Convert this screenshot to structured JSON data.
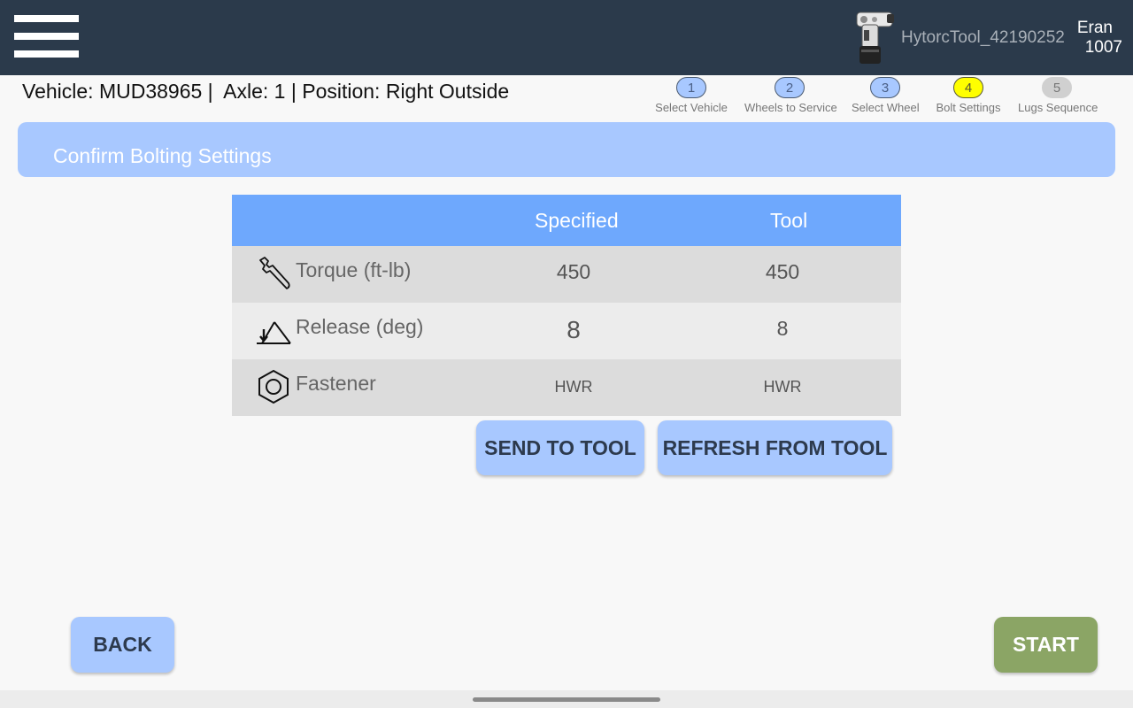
{
  "header": {
    "tool_name": "HytorcTool_42190252",
    "user_name": "Eran",
    "user_id": "1007"
  },
  "vehicle_info": "Vehicle: MUD38965 |  Axle: 1 | Position: Right Outside",
  "steps": [
    {
      "number": "1",
      "label": "Select Vehicle",
      "state": "done"
    },
    {
      "number": "2",
      "label": "Wheels to Service",
      "state": "done"
    },
    {
      "number": "3",
      "label": "Select Wheel",
      "state": "done"
    },
    {
      "number": "4",
      "label": "Bolt Settings",
      "state": "current"
    },
    {
      "number": "5",
      "label": "Lugs Sequence",
      "state": "pending"
    }
  ],
  "banner_title": "Confirm Bolting Settings",
  "table": {
    "headers": [
      "",
      "Specified",
      "Tool"
    ],
    "rows": [
      {
        "label": "Torque (ft-lb)",
        "icon": "wrench-icon",
        "specified": "450",
        "tool": "450"
      },
      {
        "label": "Release (deg)",
        "icon": "release-angle-icon",
        "specified": "8",
        "tool": "8"
      },
      {
        "label": "Fastener",
        "icon": "hex-nut-icon",
        "specified": "HWR",
        "tool": "HWR"
      }
    ]
  },
  "buttons": {
    "send": "SEND TO TOOL",
    "refresh": "REFRESH FROM TOOL",
    "back": "BACK",
    "start": "START"
  },
  "colors": {
    "topbar": "#2b3a4b",
    "accent_blue": "#a8c8ff",
    "table_header": "#6ea8fd",
    "current_step": "#ffff00",
    "pending_step": "#d0d0d0",
    "start_green": "#8ba565"
  }
}
